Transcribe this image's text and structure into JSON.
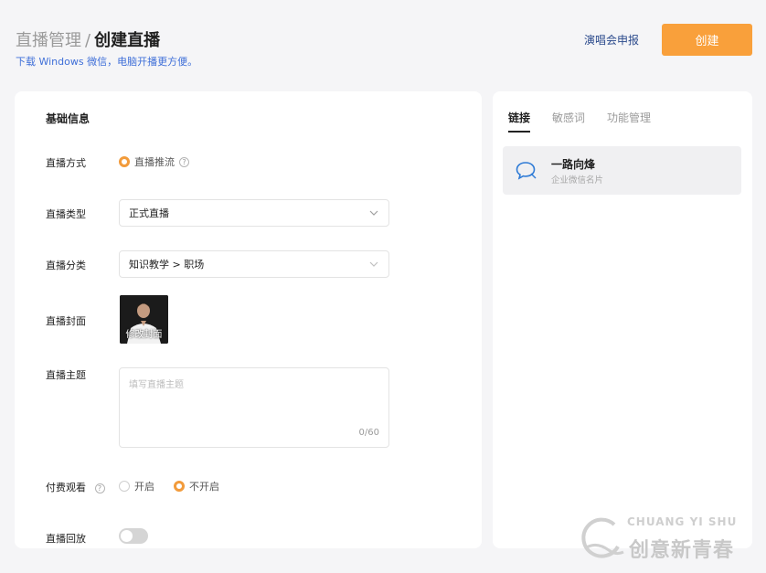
{
  "header": {
    "breadcrumb_parent": "直播管理",
    "breadcrumb_separator": "/",
    "breadcrumb_current": "创建直播",
    "subtitle": "下载 Windows 微信，电脑开播更方便。",
    "concert_link": "演唱会申报",
    "create_button": "创建"
  },
  "form": {
    "section_title": "基础信息",
    "live_mode": {
      "label": "直播方式",
      "option": "直播推流",
      "help_glyph": "?"
    },
    "live_type": {
      "label": "直播类型",
      "value": "正式直播"
    },
    "category": {
      "label": "直播分类",
      "value": "知识教学 > 职场"
    },
    "cover": {
      "label": "直播封面",
      "overlay_text": "修改封面"
    },
    "topic": {
      "label": "直播主题",
      "placeholder": "填写直播主题",
      "counter": "0/60"
    },
    "paid": {
      "label": "付费观看",
      "help_glyph": "?",
      "options": [
        "开启",
        "不开启"
      ],
      "selected": "不开启"
    },
    "replay": {
      "label": "直播回放",
      "enabled": false
    }
  },
  "side": {
    "tabs": [
      "链接",
      "敏感词",
      "功能管理"
    ],
    "active_tab": "链接",
    "contact": {
      "name": "一路向烽",
      "subtitle": "企业微信名片",
      "icon": "chat-bubble-icon"
    }
  },
  "watermark": {
    "top": "CHUANG YI SHU",
    "bottom": "创意新青春"
  },
  "colors": {
    "accent": "#f9a03b",
    "link": "#3f6fd8",
    "background": "#f5f5f7"
  }
}
